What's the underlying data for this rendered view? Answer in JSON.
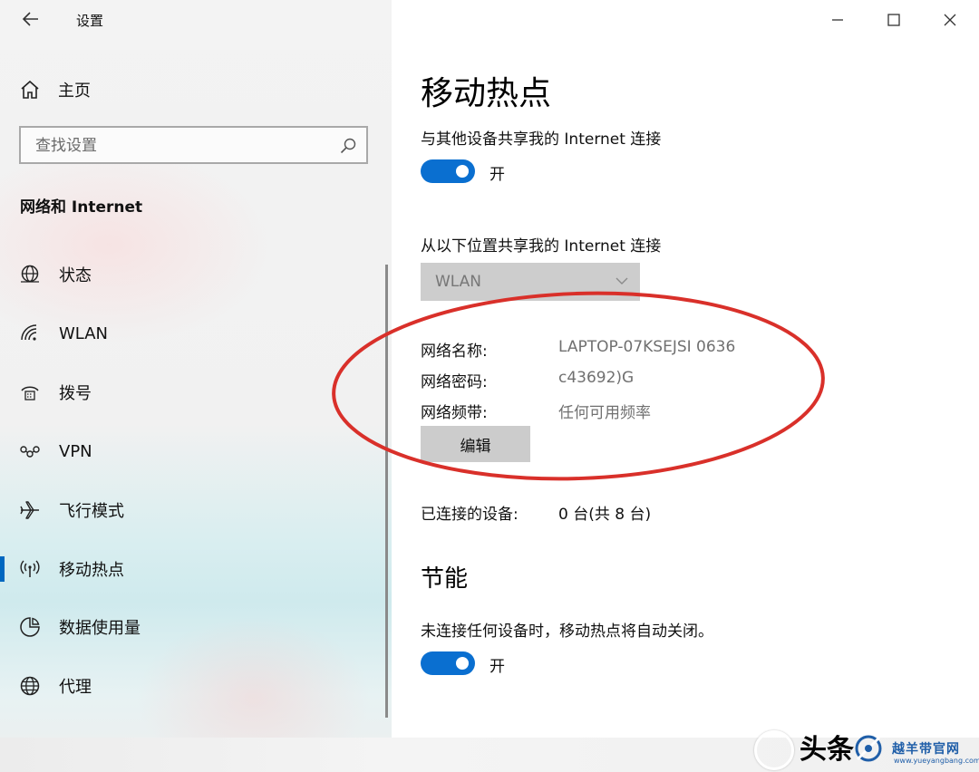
{
  "window": {
    "title": "设置"
  },
  "sidebar": {
    "home_label": "主页",
    "search_placeholder": "查找设置",
    "section_title": "网络和 Internet",
    "items": [
      {
        "label": "状态",
        "icon": "globe-status-icon"
      },
      {
        "label": "WLAN",
        "icon": "wifi-icon"
      },
      {
        "label": "拨号",
        "icon": "dialup-icon"
      },
      {
        "label": "VPN",
        "icon": "vpn-icon"
      },
      {
        "label": "飞行模式",
        "icon": "airplane-icon"
      },
      {
        "label": "移动热点",
        "icon": "hotspot-icon",
        "active": true
      },
      {
        "label": "数据使用量",
        "icon": "data-usage-icon"
      },
      {
        "label": "代理",
        "icon": "globe-icon"
      }
    ]
  },
  "main": {
    "page_title": "移动热点",
    "share_label": "与其他设备共享我的 Internet 连接",
    "share_toggle_text": "开",
    "share_from_label": "从以下位置共享我的 Internet 连接",
    "share_from_value": "WLAN",
    "network_name_key": "网络名称:",
    "network_name_value": "LAPTOP-07KSEJSI 0636",
    "network_password_key": "网络密码:",
    "network_password_value": "c43692)G",
    "network_band_key": "网络频带:",
    "network_band_value": "任何可用频率",
    "edit_label": "编辑",
    "connected_key": "已连接的设备:",
    "connected_value": "0 台(共 8 台)",
    "power_title": "节能",
    "power_label": "未连接任何设备时，移动热点将自动关闭。",
    "power_toggle_text": "开"
  },
  "watermark": {
    "text1": "头条",
    "text2": "越羊带官网",
    "text3": "www.yueyangbang.com"
  },
  "colors": {
    "accent": "#0067c0",
    "toggle": "#0a6fd0",
    "annotation": "#d9302a"
  }
}
